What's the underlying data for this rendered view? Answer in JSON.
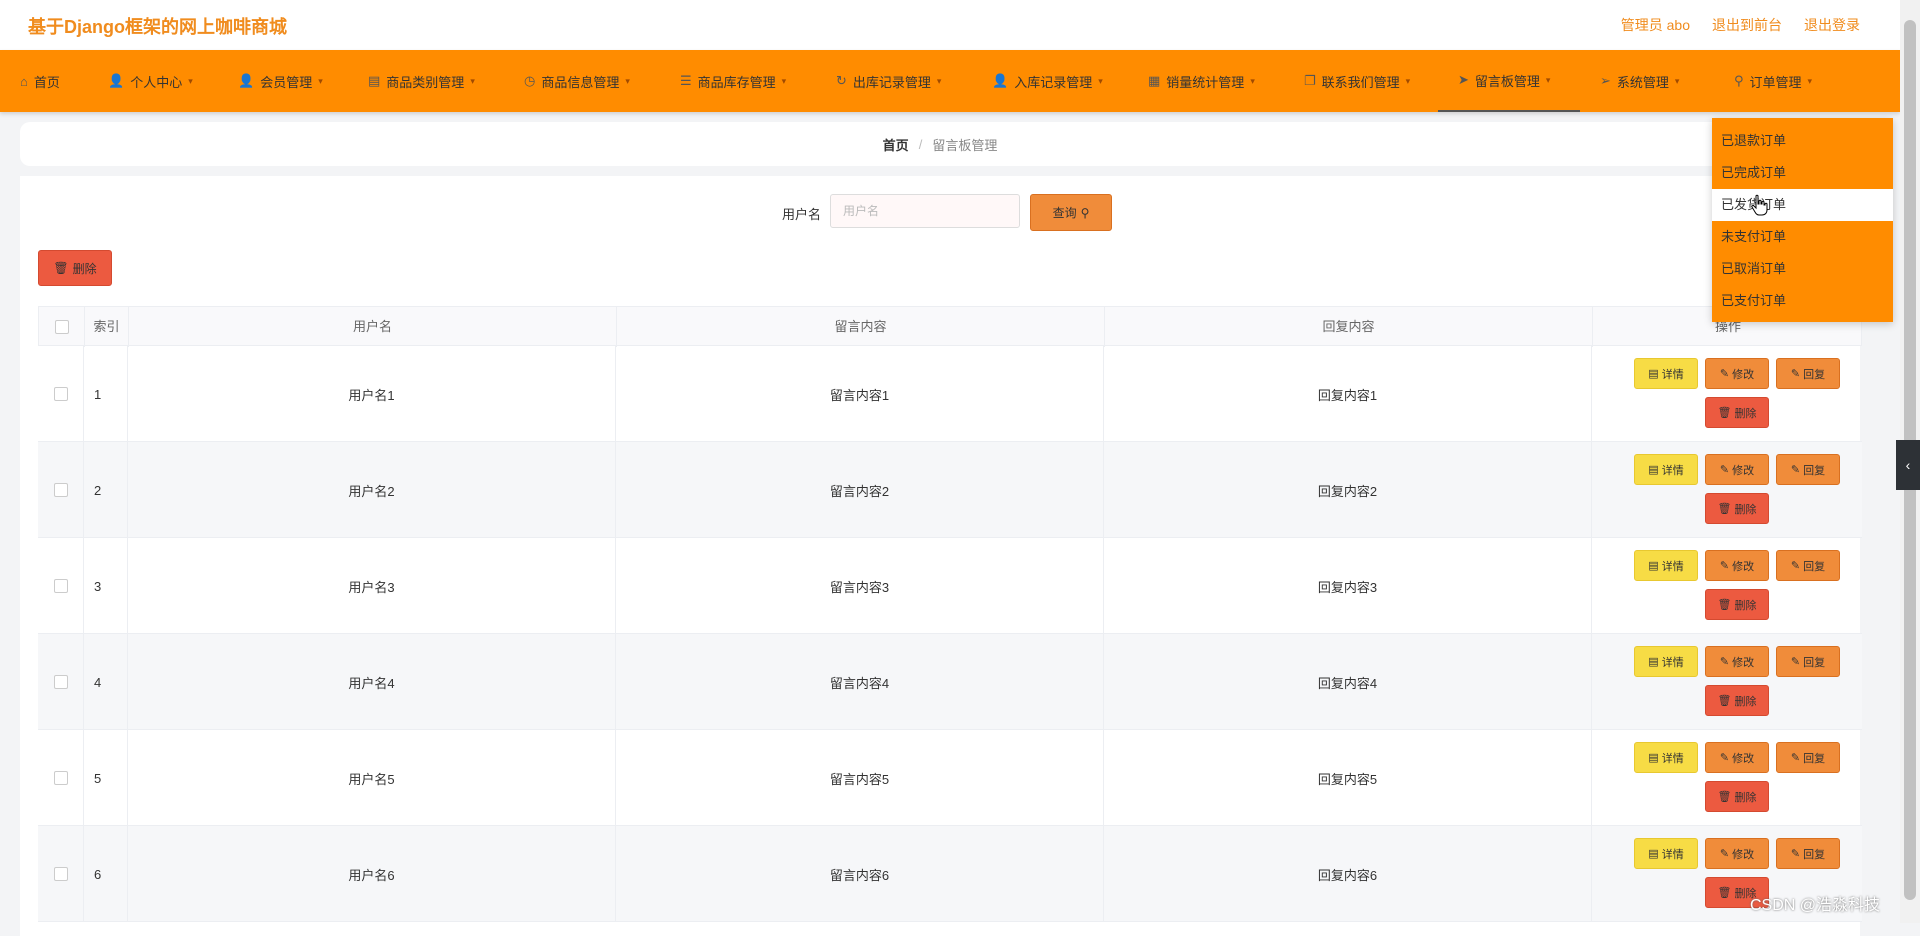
{
  "header": {
    "title": "基于Django框架的网上咖啡商城",
    "links": [
      "管理员 abo",
      "退出到前台",
      "退出登录"
    ]
  },
  "nav": [
    {
      "label": "首页",
      "icon": "home-icon"
    },
    {
      "label": "个人中心",
      "icon": "user-icon"
    },
    {
      "label": "会员管理",
      "icon": "user-icon"
    },
    {
      "label": "商品类别管理",
      "icon": "document-icon"
    },
    {
      "label": "商品信息管理",
      "icon": "clock-icon"
    },
    {
      "label": "商品库存管理",
      "icon": "list-icon"
    },
    {
      "label": "出库记录管理",
      "icon": "refresh-icon"
    },
    {
      "label": "入库记录管理",
      "icon": "user-icon"
    },
    {
      "label": "销量统计管理",
      "icon": "grid-icon"
    },
    {
      "label": "联系我们管理",
      "icon": "copy-icon"
    },
    {
      "label": "留言板管理",
      "icon": "send-icon"
    },
    {
      "label": "系统管理",
      "icon": "send-icon"
    },
    {
      "label": "订单管理",
      "icon": "pin-icon"
    }
  ],
  "breadcrumb": {
    "home": "首页",
    "separator": "/",
    "current": "留言板管理"
  },
  "search": {
    "label": "用户名",
    "placeholder": "用户名",
    "button": "查询"
  },
  "toolbar": {
    "delete": "删除"
  },
  "table": {
    "headers": [
      "索引",
      "用户名",
      "留言内容",
      "回复内容",
      "操作"
    ],
    "rows": [
      [
        "1",
        "用户名1",
        "留言内容1",
        "回复内容1"
      ],
      [
        "2",
        "用户名2",
        "留言内容2",
        "回复内容2"
      ],
      [
        "3",
        "用户名3",
        "留言内容3",
        "回复内容3"
      ],
      [
        "4",
        "用户名4",
        "留言内容4",
        "回复内容4"
      ],
      [
        "5",
        "用户名5",
        "留言内容5",
        "回复内容5"
      ],
      [
        "6",
        "用户名6",
        "留言内容6",
        "回复内容6"
      ]
    ],
    "actions": {
      "detail": "详情",
      "edit": "修改",
      "reply": "回复",
      "delete": "删除"
    }
  },
  "dropdown": {
    "items": [
      "已退款订单",
      "已完成订单",
      "已发货订单",
      "未支付订单",
      "已取消订单",
      "已支付订单"
    ],
    "hovered": "已发货订单"
  },
  "watermark": "CSDN @浩淼科技",
  "colors": {
    "accent": "#ff8c00",
    "title": "#f08c1e",
    "danger": "#ec5a40",
    "warning": "#f7dc45"
  }
}
